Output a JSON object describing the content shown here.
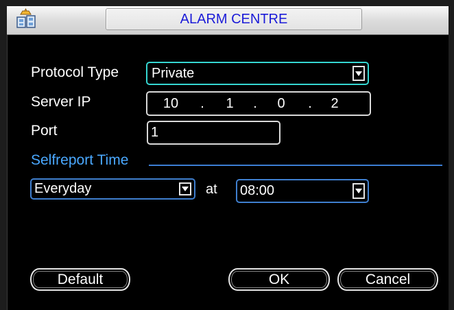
{
  "window": {
    "title": "ALARM CENTRE",
    "icon": "alarm-centre-app-icon"
  },
  "form": {
    "protocol_type": {
      "label": "Protocol Type",
      "value": "Private"
    },
    "server_ip": {
      "label": "Server IP",
      "octets": [
        "10",
        "1",
        "0",
        "2"
      ],
      "separator": "."
    },
    "port": {
      "label": "Port",
      "value": "1"
    },
    "selfreport_time": {
      "label": "Selfreport Time",
      "frequency": "Everyday",
      "at_label": "at",
      "time": "08:00"
    }
  },
  "buttons": {
    "default": "Default",
    "ok": "OK",
    "cancel": "Cancel"
  },
  "colors": {
    "title_text": "#1b1bd8",
    "section_label": "#4aa8ff",
    "focused_border": "#35d7d2",
    "selected_border": "#3f7fcf",
    "background": "#000000"
  }
}
